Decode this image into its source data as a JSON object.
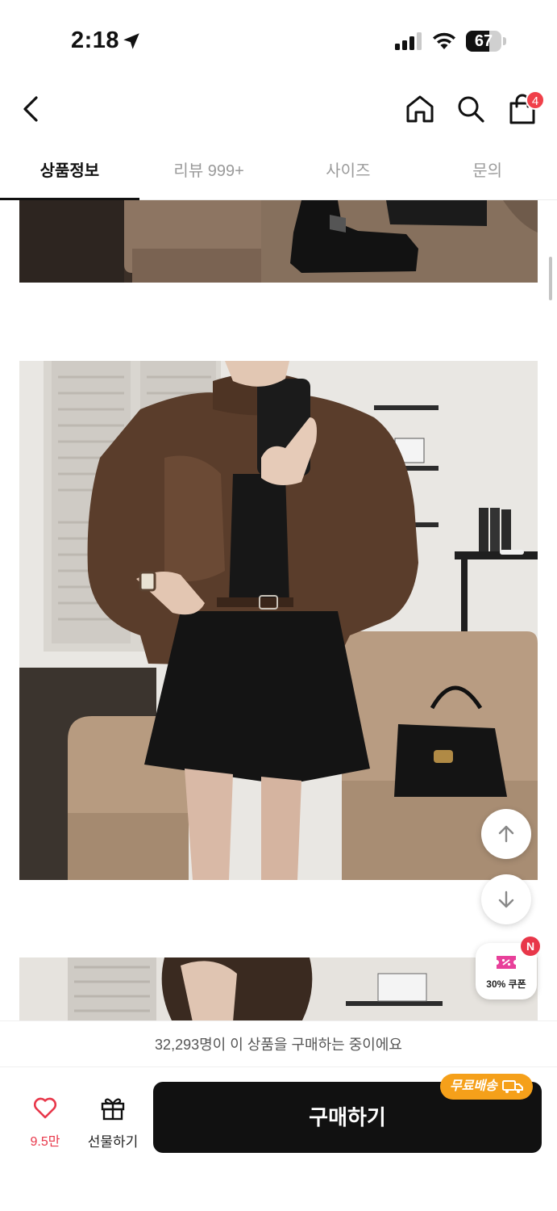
{
  "status_bar": {
    "time": "2:18",
    "battery": "67",
    "battery_level": 0.67
  },
  "nav": {
    "cart_count": "4"
  },
  "tabs": [
    {
      "label": "상품정보",
      "active": true
    },
    {
      "label": "리뷰 999+",
      "active": false
    },
    {
      "label": "사이즈",
      "active": false
    },
    {
      "label": "문의",
      "active": false
    }
  ],
  "coupon": {
    "label": "30% 쿠폰",
    "badge": "N"
  },
  "purchase_banner": "32,293명이 이 상품을 구매하는 중이에요",
  "bottom": {
    "like_count": "9.5만",
    "gift_label": "선물하기",
    "buy_label": "구매하기",
    "free_shipping": "무료배송"
  },
  "colors": {
    "accent": "#e8374a",
    "buy_button": "#111111",
    "free_shipping": "#f5a01a"
  }
}
